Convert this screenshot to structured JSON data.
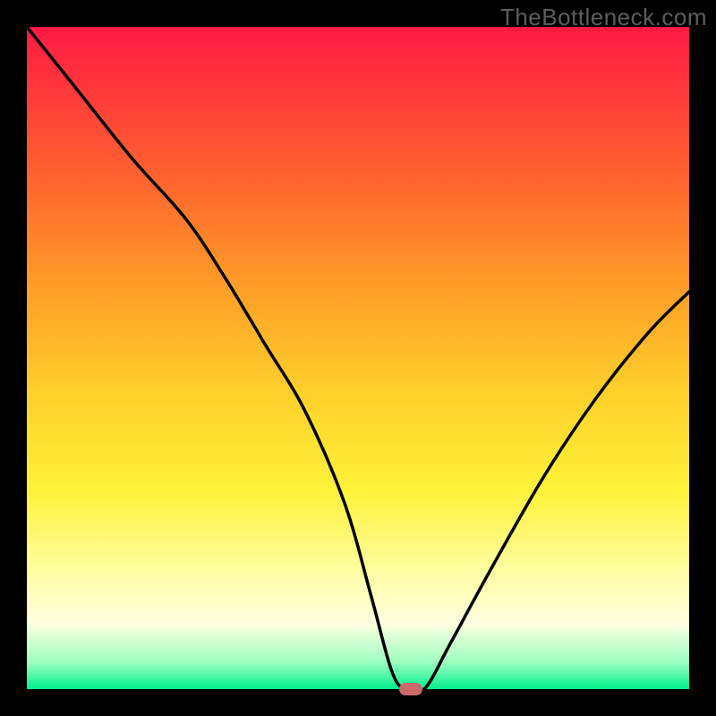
{
  "watermark": "TheBottleneck.com",
  "chart_data": {
    "type": "line",
    "title": "",
    "xlabel": "",
    "ylabel": "",
    "xlim": [
      0,
      100
    ],
    "ylim": [
      0,
      100
    ],
    "grid": false,
    "legend": false,
    "series": [
      {
        "name": "bottleneck-curve",
        "x": [
          0,
          8,
          16,
          24,
          30,
          36,
          42,
          48,
          52,
          55,
          57,
          60,
          64,
          70,
          78,
          86,
          94,
          100
        ],
        "values": [
          100,
          90,
          80,
          71,
          62,
          52,
          42,
          28,
          14,
          3,
          0,
          0,
          7,
          18,
          32,
          44,
          54,
          60
        ]
      }
    ],
    "marker": {
      "x": 58,
      "y": 0,
      "color": "#c96a6a"
    },
    "background_gradient": {
      "top": "#ff1a44",
      "mid": "#fff238",
      "bottom": "#00f08a"
    }
  }
}
